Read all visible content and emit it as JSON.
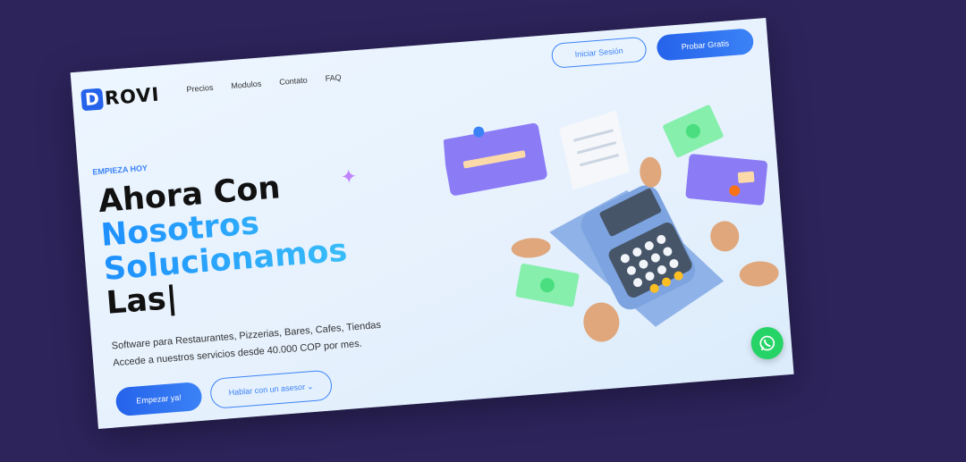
{
  "logo": {
    "mark": "D",
    "text": "ROVI"
  },
  "nav": {
    "items": [
      "Precios",
      "Modulos",
      "Contato",
      "FAQ"
    ]
  },
  "header": {
    "login_label": "Iniciar Sesión",
    "trial_label": "Probar Gratis"
  },
  "hero": {
    "eyebrow": "EMPIEZA HOY",
    "line1": "Ahora Con",
    "line2": "Nosotros",
    "line3": "Solucionamos",
    "line4": "Las|",
    "desc1": "Software para Restaurantes, Pizzerias, Bares, Cafes, Tiendas",
    "desc2": "Accede a nuestros servicios desde 40.000 COP por mes.",
    "start_label": "Empezar ya!",
    "advisor_label": "Hablar con un asesor"
  },
  "colors": {
    "background": "#2d245c",
    "accent": "#2563eb",
    "whatsapp": "#25d366"
  }
}
